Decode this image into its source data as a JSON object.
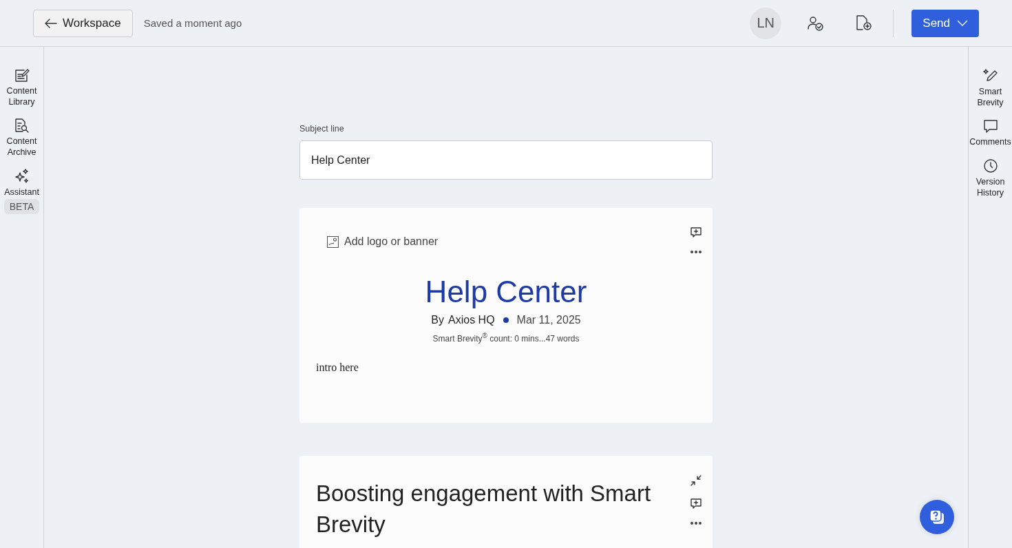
{
  "header": {
    "back_button": "Workspace",
    "save_status": "Saved a moment ago",
    "avatar_initials": "LN",
    "send_button": "Send"
  },
  "left_rail": [
    {
      "label": "Content Library",
      "kind": "library"
    },
    {
      "label": "Content Archive",
      "kind": "archive"
    },
    {
      "label": "Assistant",
      "kind": "assistant",
      "badge": "BETA"
    }
  ],
  "right_rail": [
    {
      "label": "Smart Brevity",
      "kind": "brevity"
    },
    {
      "label": "Comments",
      "kind": "comments"
    },
    {
      "label": "Version History",
      "kind": "history"
    }
  ],
  "subject": {
    "label": "Subject line",
    "value": "Help Center"
  },
  "intro_card": {
    "add_logo": "Add logo or banner",
    "title": "Help Center",
    "byline_prefix": "By",
    "author": "Axios HQ",
    "date": "Mar 11, 2025",
    "count": "Smart Brevity$^{®}$ count: 0 mins...47 words",
    "intro": "intro here"
  },
  "section_card": {
    "heading": "Boosting engagement with Smart Brevity"
  }
}
